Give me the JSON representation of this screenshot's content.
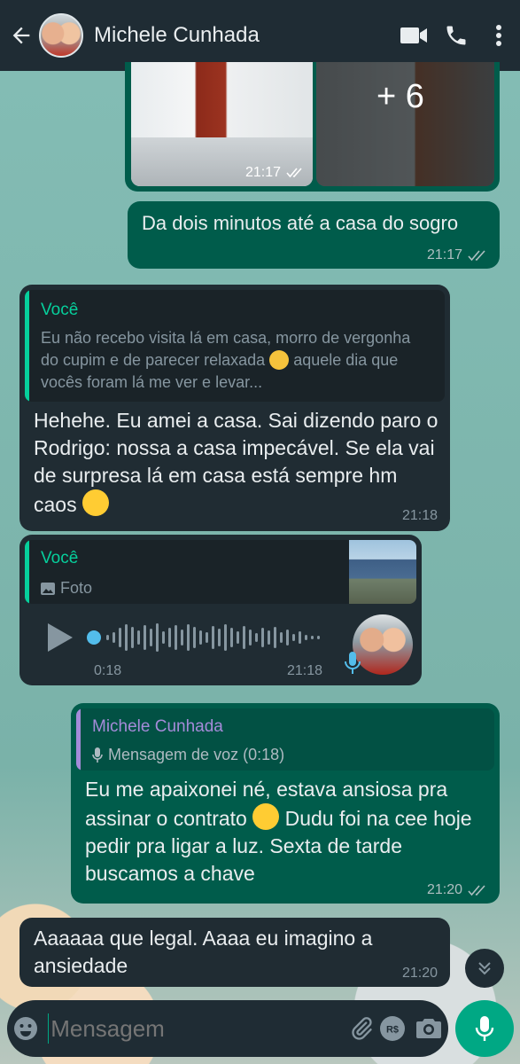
{
  "header": {
    "contact_name": "Michele Cunhada"
  },
  "messages": {
    "photo_group": {
      "time": "21:17",
      "more_count": "+ 6"
    },
    "msg1": {
      "text": "Da dois minutos até a casa do sogro",
      "time": "21:17"
    },
    "msg2": {
      "quote_name": "Você",
      "quote_text": "Eu não recebo visita lá em casa, morro de vergonha do cupim e de parecer relaxada",
      "quote_text2": "aquele dia que vocês foram lá me ver e levar...",
      "text": "Hehehe. Eu amei a casa. Sai dizendo paro o Rodrigo: nossa a casa impecável. Se ela vai de surpresa lá em casa está sempre hm caos",
      "time": "21:18"
    },
    "voice": {
      "quote_name": "Você",
      "quote_label": "Foto",
      "duration": "0:18",
      "time": "21:18"
    },
    "msg3": {
      "quote_name": "Michele Cunhada",
      "quote_text": "Mensagem de voz (0:18)",
      "text_a": "Eu me apaixonei né, estava ansiosa pra assinar o contrato",
      "text_b": "Dudu foi na cee hoje pedir pra ligar a luz. Sexta de tarde buscamos a chave",
      "time": "21:20"
    },
    "msg4": {
      "text": "Aaaaaa que legal. Aaaa eu imagino a ansiedade",
      "time": "21:20"
    }
  },
  "composer": {
    "placeholder": "Mensagem"
  },
  "colors": {
    "outgoing": "#005c4b",
    "incoming": "#202c33",
    "accent": "#00a884"
  }
}
